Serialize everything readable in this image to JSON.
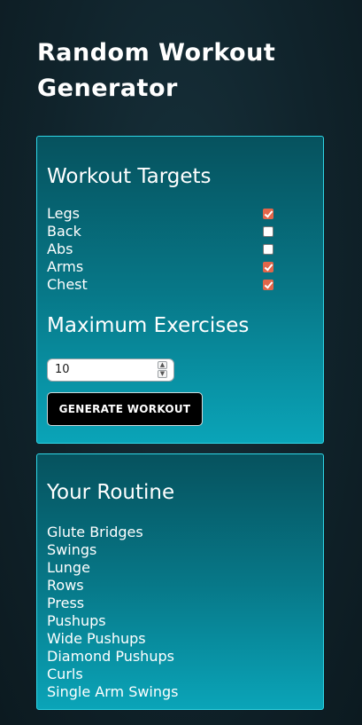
{
  "app": {
    "title": "Random Workout Generator"
  },
  "targets_panel": {
    "heading": "Workout Targets",
    "options": [
      {
        "label": "Legs",
        "checked": true
      },
      {
        "label": "Back",
        "checked": false
      },
      {
        "label": "Abs",
        "checked": false
      },
      {
        "label": "Arms",
        "checked": true
      },
      {
        "label": "Chest",
        "checked": true
      }
    ],
    "max_heading": "Maximum Exercises",
    "max_value": "10",
    "generate_label": "GENERATE WORKOUT"
  },
  "routine_panel": {
    "heading": "Your Routine",
    "items": [
      "Glute Bridges",
      "Swings",
      "Lunge",
      "Rows",
      "Press",
      "Pushups",
      "Wide Pushups",
      "Diamond Pushups",
      "Curls",
      "Single Arm Swings"
    ]
  },
  "colors": {
    "checkbox_checked": "#e2664a",
    "panel_border": "#2fd6e6",
    "button_background": "#000000"
  }
}
